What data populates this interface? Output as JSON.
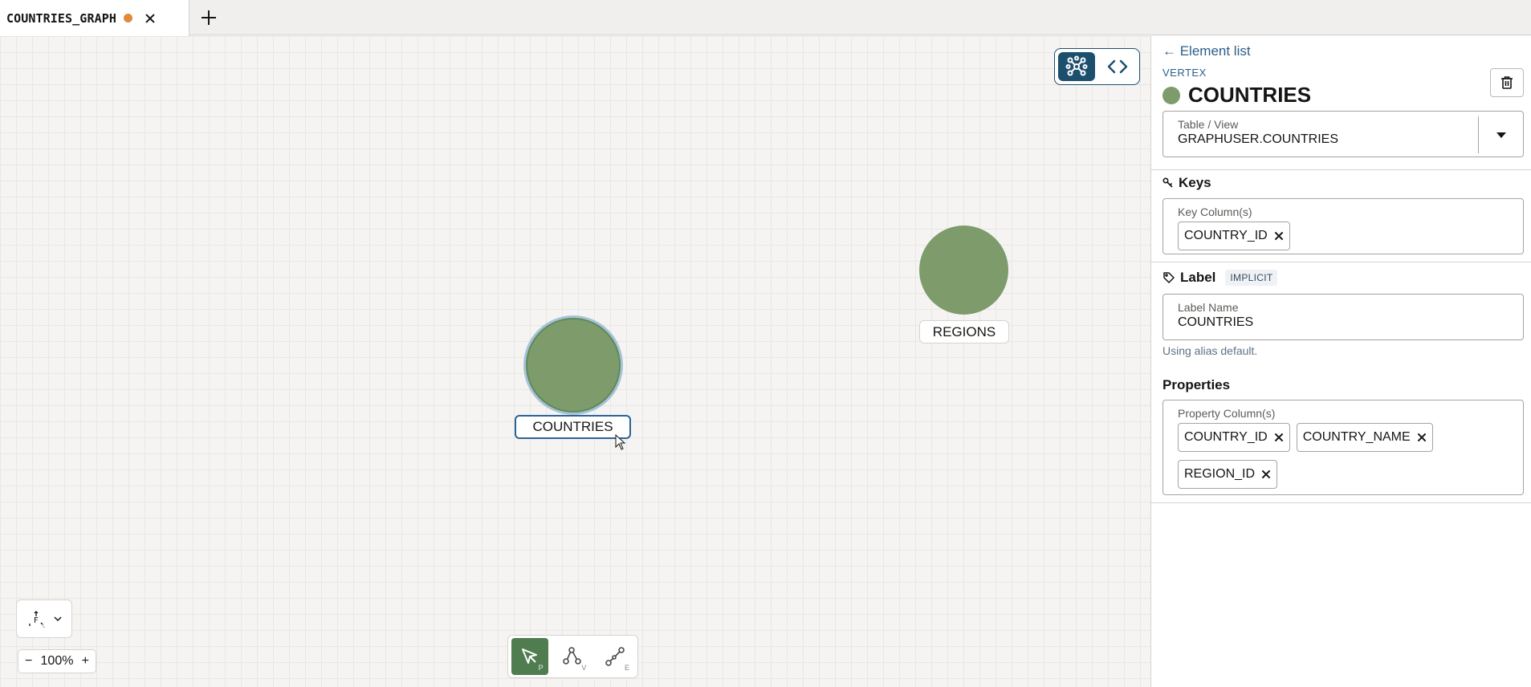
{
  "tab": {
    "title": "COUNTRIES_GRAPH"
  },
  "canvas": {
    "vertices": [
      {
        "label": "COUNTRIES",
        "selected": true
      },
      {
        "label": "REGIONS",
        "selected": false
      }
    ],
    "zoom": {
      "minus": "−",
      "value": "100%",
      "plus": "+"
    },
    "tools": [
      {
        "name": "pointer",
        "shortcut": "P"
      },
      {
        "name": "vertex",
        "shortcut": "V"
      },
      {
        "name": "edge",
        "shortcut": "E"
      }
    ]
  },
  "panel": {
    "back_link": "← Element list",
    "kind": "VERTEX",
    "element_name": "COUNTRIES",
    "element_color": "#7e9b6b",
    "table_view": {
      "label": "Table / View",
      "value": "GRAPHUSER.COUNTRIES"
    },
    "keys": {
      "heading": "Keys",
      "field_label": "Key Column(s)",
      "chips": [
        "COUNTRY_ID"
      ]
    },
    "label": {
      "heading": "Label",
      "badge": "IMPLICIT",
      "field_label": "Label Name",
      "value": "COUNTRIES",
      "hint": "Using alias default."
    },
    "properties": {
      "heading": "Properties",
      "field_label": "Property Column(s)",
      "chips": [
        "COUNTRY_ID",
        "COUNTRY_NAME",
        "REGION_ID"
      ]
    }
  },
  "colors": {
    "accent": "#1c4f6e",
    "vertex": "#7e9b6b",
    "dirty": "#e08a3c",
    "link": "#2a5f8a"
  }
}
